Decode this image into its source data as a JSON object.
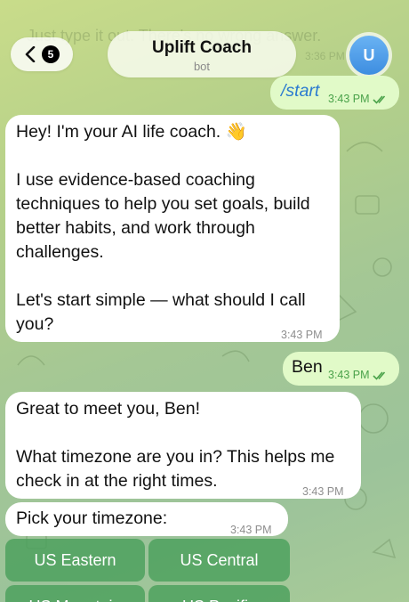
{
  "header": {
    "back_badge": "5",
    "title": "Uplift Coach",
    "subtitle": "bot",
    "avatar_letter": "U"
  },
  "ghost": {
    "text": "Just type it out. There's no wrong answer.",
    "time": "3:36 PM"
  },
  "messages": [
    {
      "dir": "out",
      "text": "/start",
      "time": "3:43 PM"
    },
    {
      "dir": "in",
      "text": "Hey! I'm your AI life coach. 👋\n\nI use evidence-based coaching techniques to help you set goals, build better habits, and work through challenges.\n\nLet's start simple — what should I call you?",
      "time": "3:43 PM"
    },
    {
      "dir": "out",
      "text": "Ben",
      "time": "3:43 PM"
    },
    {
      "dir": "in",
      "text": "Great to meet you, Ben!\n\nWhat timezone are you in? This helps me check in at the right times.",
      "time": "3:43 PM"
    },
    {
      "dir": "in",
      "text": "Pick your timezone:",
      "time": "3:43 PM"
    }
  ],
  "keyboard": [
    {
      "label": "US Eastern"
    },
    {
      "label": "US Central"
    },
    {
      "label": "US Mountain"
    },
    {
      "label": "US Pacific"
    }
  ],
  "colors": {
    "outgoing_bubble": "#e1fac8",
    "incoming_bubble": "#ffffff",
    "keyboard_button": "#4aa05c",
    "read_tick": "#4aa24a",
    "avatar": "#3d8de0"
  }
}
